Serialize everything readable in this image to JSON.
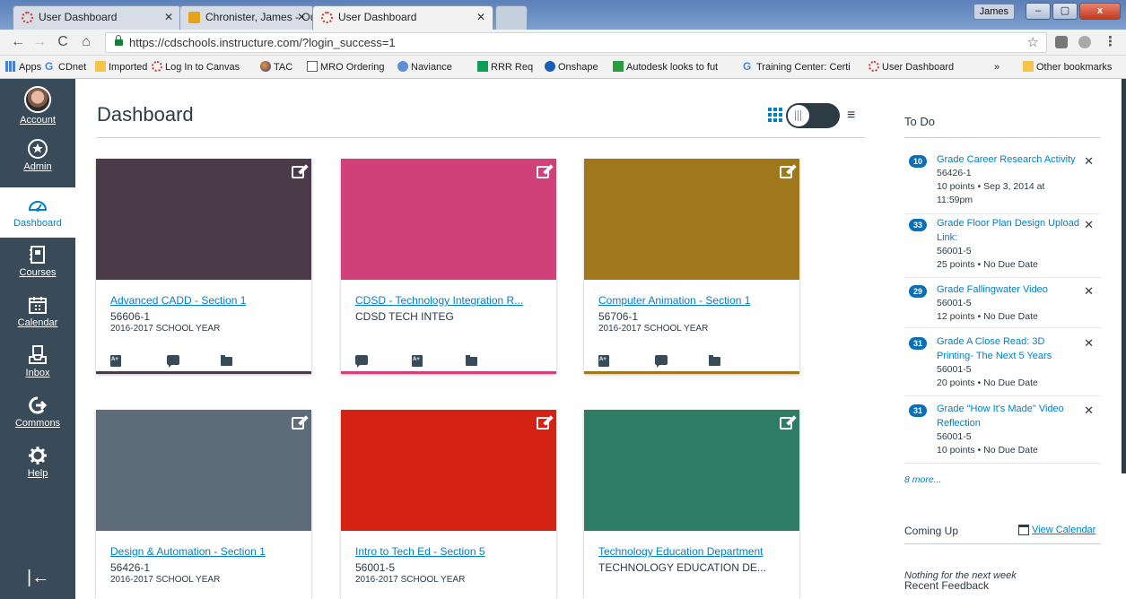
{
  "browser": {
    "tabs": [
      {
        "title": "User Dashboard",
        "favicon": "canvas-icon",
        "active": false
      },
      {
        "title": "Chronister, James - Outlo",
        "favicon": "outlook-icon",
        "active": false
      },
      {
        "title": "User Dashboard",
        "favicon": "canvas-icon",
        "active": true
      }
    ],
    "window_user": "James",
    "window_controls": {
      "minimize": "–",
      "maximize": "▢",
      "close": "x"
    },
    "url": "https://cdschools.instructure.com/?login_success=1",
    "bookmarks": [
      {
        "label": "Apps",
        "icon": "apps"
      },
      {
        "label": "CDnet",
        "icon": "g"
      },
      {
        "label": "Imported",
        "icon": "folder"
      },
      {
        "label": "Log In to Canvas",
        "icon": "canvas"
      },
      {
        "label": "TAC",
        "icon": "tac"
      },
      {
        "label": "MRO Ordering",
        "icon": "doc"
      },
      {
        "label": "Naviance",
        "icon": "nav"
      },
      {
        "label": "RRR Req",
        "icon": "sheet"
      },
      {
        "label": "Onshape",
        "icon": "onshape"
      },
      {
        "label": "Autodesk looks to fut",
        "icon": "tc"
      },
      {
        "label": "Training Center: Certi",
        "icon": "g"
      },
      {
        "label": "User Dashboard",
        "icon": "canvas"
      }
    ],
    "overflow": "»",
    "other_bookmarks": "Other bookmarks"
  },
  "globalnav": {
    "items": [
      {
        "label": "Account",
        "icon": "avatar-icon"
      },
      {
        "label": "Admin",
        "icon": "shield-icon"
      },
      {
        "label": "Dashboard",
        "icon": "speedometer-icon",
        "active": true
      },
      {
        "label": "Courses",
        "icon": "book-icon"
      },
      {
        "label": "Calendar",
        "icon": "calendar-icon"
      },
      {
        "label": "Inbox",
        "icon": "inbox-icon"
      },
      {
        "label": "Commons",
        "icon": "commons-icon"
      },
      {
        "label": "Help",
        "icon": "help-icon"
      }
    ],
    "collapse": "|←"
  },
  "dashboard": {
    "title": "Dashboard",
    "list_icon": "≡",
    "cards": [
      {
        "title": "Advanced CADD - Section 1",
        "code": "56606-1",
        "term": "2016-2017 SCHOOL YEAR",
        "color": "#4a3a4a",
        "actions": [
          "assignments",
          "discussions",
          "files"
        ]
      },
      {
        "title": "CDSD - Technology Integration R...",
        "code": "CDSD TECH INTEG",
        "term": "",
        "color": "#d04179",
        "actions": [
          "discussions",
          "assignments",
          "files"
        ]
      },
      {
        "title": "Computer Animation - Section 1",
        "code": "56706-1",
        "term": "2016-2017 SCHOOL YEAR",
        "color": "#a1771b",
        "actions": [
          "assignments",
          "discussions",
          "files"
        ]
      },
      {
        "title": "Design & Automation - Section 1",
        "code": "56426-1",
        "term": "2016-2017 SCHOOL YEAR",
        "color": "#5e6b78",
        "actions": []
      },
      {
        "title": "Intro to Tech Ed - Section 5",
        "code": "56001-5",
        "term": "2016-2017 SCHOOL YEAR",
        "color": "#d42314",
        "actions": []
      },
      {
        "title": "Technology Education Department",
        "code": "TECHNOLOGY EDUCATION DE...",
        "term": "",
        "color": "#2d7c63",
        "actions": []
      }
    ]
  },
  "sidebar": {
    "todo_title": "To Do",
    "todos": [
      {
        "count": "10",
        "title": "Grade Career Research Activity",
        "code": "56426-1",
        "meta": "10 points • Sep 3, 2014 at 11:59pm"
      },
      {
        "count": "33",
        "title": "Grade Floor Plan Design Upload Link:",
        "code": "56001-5",
        "meta": "25 points • No Due Date"
      },
      {
        "count": "29",
        "title": "Grade Fallingwater Video",
        "code": "56001-5",
        "meta": "12 points • No Due Date"
      },
      {
        "count": "31",
        "title": "Grade A Close Read: 3D Printing- The Next 5 Years",
        "code": "56001-5",
        "meta": "20 points • No Due Date"
      },
      {
        "count": "31",
        "title": "Grade \"How It's Made\" Video Reflection",
        "code": "56001-5",
        "meta": "10 points • No Due Date"
      }
    ],
    "more": "8 more...",
    "coming_up": "Coming Up",
    "view_calendar": "View Calendar",
    "nothing": "Nothing for the next week",
    "recent_feedback": "Recent Feedback"
  }
}
